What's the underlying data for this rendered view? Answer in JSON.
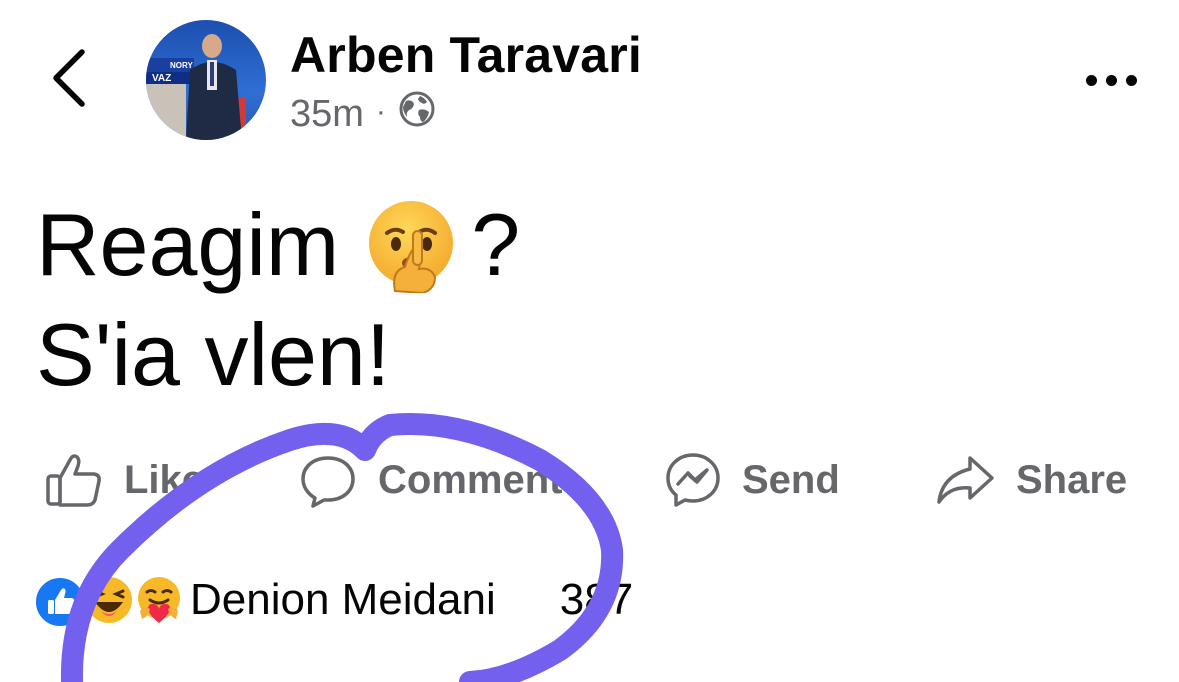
{
  "header": {
    "back_icon": "chevron-left-icon",
    "author_name": "Arben Taravari",
    "time": "35m",
    "separator": "·",
    "audience_icon": "globe-icon",
    "more_icon": "ellipsis-icon"
  },
  "post": {
    "line1": "Reagim",
    "line1_emoji": "shushing-face",
    "line1_suffix": "?",
    "line2": "S'ia vlen!"
  },
  "actions": [
    {
      "label": "Like",
      "icon": "thumbs-up-icon"
    },
    {
      "label": "Comment",
      "icon": "comment-icon"
    },
    {
      "label": "Send",
      "icon": "messenger-icon"
    },
    {
      "label": "Share",
      "icon": "share-icon"
    }
  ],
  "reactions": {
    "icons": [
      "like",
      "haha",
      "care"
    ],
    "top_name": "Denion Meidani",
    "count": "387"
  },
  "colors": {
    "primary_text": "#050505",
    "secondary_text": "#65676b",
    "like_blue": "#1877f2",
    "marker_purple": "#7460ee"
  }
}
